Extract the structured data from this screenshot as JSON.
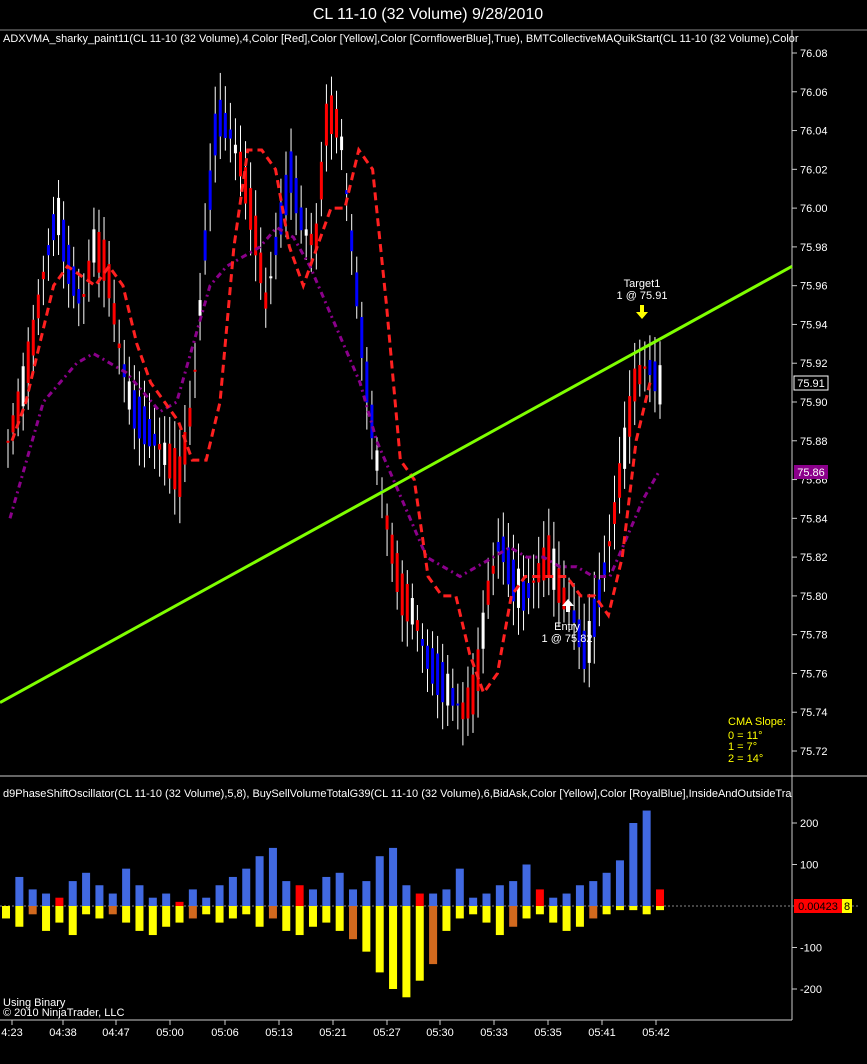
{
  "window_title": "CL 11-10 (32 Volume)  9/28/2010",
  "price_panel": {
    "indicator_header": "ADXVMA_sharky_paint11(CL 11-10 (32 Volume),4,Color [Red],Color [Yellow],Color [CornflowerBlue],True), BMTCollectiveMAQuikStart(CL 11-10 (32 Volume),Color",
    "y_ticks": [
      "76.08",
      "76.06",
      "76.04",
      "76.02",
      "76.00",
      "75.98",
      "75.96",
      "75.94",
      "75.92",
      "75.90",
      "75.88",
      "75.86",
      "75.84",
      "75.82",
      "75.80",
      "75.78",
      "75.76",
      "75.74",
      "75.72"
    ],
    "last_price_badge": "75.91",
    "ma_badge": "75.86",
    "target_label": "Target1",
    "target_detail": "1 @ 75.91",
    "entry_label": "Entry",
    "entry_detail": "1 @ 75.82",
    "cma_slope_title": "CMA Slope:",
    "cma_slope_lines": [
      "0 = 11°",
      "1 = 7°",
      "2 = 14°"
    ]
  },
  "oscillator_panel": {
    "indicator_header": "d9PhaseShiftOscillator(CL 11-10 (32 Volume),5,8), BuySellVolumeTotalG39(CL 11-10 (32 Volume),6,BidAsk,Color [Yellow],Color [RoyalBlue],InsideAndOutsideTra",
    "y_ticks": [
      "200",
      "100",
      "-100",
      "-200"
    ],
    "value_badge": "0.00423",
    "value_badge_suffix": "8"
  },
  "x_ticks": [
    "4:23",
    "04:38",
    "04:47",
    "05:00",
    "05:06",
    "05:13",
    "05:21",
    "05:27",
    "05:30",
    "05:33",
    "05:35",
    "05:41",
    "05:42"
  ],
  "footer_line1": "Using Binary",
  "footer_line2": "© 2010 NinjaTrader, LLC",
  "colors": {
    "up_bar": "#ff0000",
    "down_bar": "#0000ff",
    "neutral_bar": "#ffffff",
    "adxvma_down": "#ff2020",
    "adxvma_up": "#6fa0ff",
    "adxvma_flat": "#ffff00",
    "collective_ma": "#8b008b",
    "trendline": "#7fff00",
    "buy_volume": "#4169e1",
    "sell_volume": "#ffff00",
    "oscillator_extra": "#d2691e"
  },
  "chart_data": [
    {
      "type": "candlestick",
      "title": "CL 11-10 (32 Volume)  9/28/2010",
      "ylim": [
        75.71,
        76.09
      ],
      "series": [
        {
          "name": "ADXVMA_sharky_paint11",
          "values": [
            75.88,
            75.9,
            75.93,
            75.96,
            75.97,
            75.965,
            75.96,
            75.97,
            75.96,
            75.93,
            75.91,
            75.9,
            75.89,
            75.87,
            75.87,
            75.9,
            75.98,
            76.03,
            76.03,
            76.02,
            75.98,
            75.96,
            75.98,
            76.0,
            76.0,
            76.03,
            76.02,
            75.95,
            75.87,
            75.86,
            75.81,
            75.8,
            75.8,
            75.77,
            75.75,
            75.76,
            75.8,
            75.81,
            75.81,
            75.81,
            75.81,
            75.8,
            75.8,
            75.79,
            75.82,
            75.88,
            75.91
          ]
        },
        {
          "name": "BMTCollectiveMAQuikStart",
          "values": [
            75.84,
            75.87,
            75.9,
            75.91,
            75.92,
            75.925,
            75.92,
            75.915,
            75.905,
            75.895,
            75.9,
            75.93,
            75.96,
            75.97,
            75.975,
            75.98,
            75.99,
            75.985,
            75.97,
            75.95,
            75.93,
            75.91,
            75.88,
            75.86,
            75.84,
            75.82,
            75.815,
            75.81,
            75.815,
            75.82,
            75.825,
            75.82,
            75.82,
            75.815,
            75.815,
            75.81,
            75.81,
            75.83,
            75.85,
            75.865
          ]
        }
      ],
      "trendline": {
        "start": [
          "4:23",
          75.745
        ],
        "end": [
          "05:42+",
          75.97
        ]
      }
    },
    {
      "type": "bar",
      "title": "d9PhaseShiftOscillator / BuySellVolumeTotalG39",
      "ylim": [
        -230,
        240
      ],
      "series": [
        {
          "name": "Buy",
          "values": [
            0,
            70,
            40,
            30,
            20,
            60,
            80,
            50,
            30,
            90,
            50,
            20,
            30,
            10,
            40,
            20,
            50,
            70,
            90,
            120,
            140,
            60,
            50,
            40,
            70,
            80,
            40,
            60,
            120,
            140,
            50,
            30,
            30,
            40,
            90,
            20,
            30,
            50,
            60,
            100,
            40,
            20,
            30,
            50,
            60,
            80,
            110,
            200,
            230,
            40
          ]
        },
        {
          "name": "Sell",
          "values": [
            -30,
            -50,
            -20,
            -60,
            -40,
            -70,
            -20,
            -30,
            -20,
            -40,
            -60,
            -70,
            -50,
            -40,
            -30,
            -20,
            -40,
            -30,
            -20,
            -50,
            -30,
            -60,
            -70,
            -50,
            -40,
            -60,
            -80,
            -110,
            -160,
            -200,
            -220,
            -180,
            -140,
            -60,
            -30,
            -20,
            -40,
            -70,
            -50,
            -30,
            -20,
            -40,
            -60,
            -50,
            -30,
            -20,
            -10,
            -10,
            -20,
            -10
          ]
        }
      ]
    }
  ]
}
